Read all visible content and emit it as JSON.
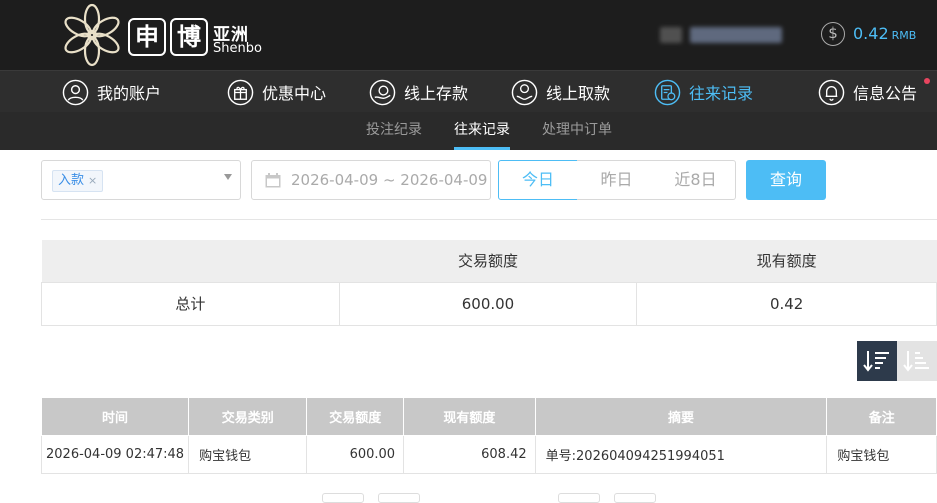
{
  "brand": {
    "box1": "申",
    "box2": "博",
    "cn": "亚洲",
    "en": "Shenbo"
  },
  "account": {
    "balance": "0.42",
    "currency": "RMB",
    "coin_symbol": "$"
  },
  "nav": {
    "items": [
      {
        "label": "我的账户",
        "icon": "user-icon"
      },
      {
        "label": "优惠中心",
        "icon": "gift-icon"
      },
      {
        "label": "线上存款",
        "icon": "deposit-icon"
      },
      {
        "label": "线上取款",
        "icon": "withdraw-icon"
      },
      {
        "label": "往来记录",
        "icon": "records-icon",
        "active": true
      },
      {
        "label": "信息公告",
        "icon": "bell-icon"
      }
    ]
  },
  "subnav": {
    "items": [
      {
        "label": "投注纪录"
      },
      {
        "label": "往来记录",
        "active": true
      },
      {
        "label": "处理中订单"
      }
    ]
  },
  "filter": {
    "type_tag": "入款",
    "tag_close": "×",
    "date_range": "2026-04-09 ~ 2026-04-09",
    "quick": [
      "今日",
      "昨日",
      "近8日"
    ],
    "query_label": "查询"
  },
  "summary": {
    "headers": [
      "",
      "交易额度",
      "现有额度"
    ],
    "row": [
      "总计",
      "600.00",
      "0.42"
    ]
  },
  "records": {
    "headers": [
      "时间",
      "交易类别",
      "交易额度",
      "现有额度",
      "摘要",
      "备注"
    ],
    "rows": [
      [
        "2026-04-09 02:47:48",
        "购宝钱包",
        "600.00",
        "608.42",
        "单号:202604094251994051",
        "购宝钱包"
      ]
    ]
  },
  "colors": {
    "accent": "#4dbdf5",
    "header_bg": "#1d1d1d",
    "nav_bg": "#2e2e2e",
    "sort_active": "#2d3a4b"
  }
}
